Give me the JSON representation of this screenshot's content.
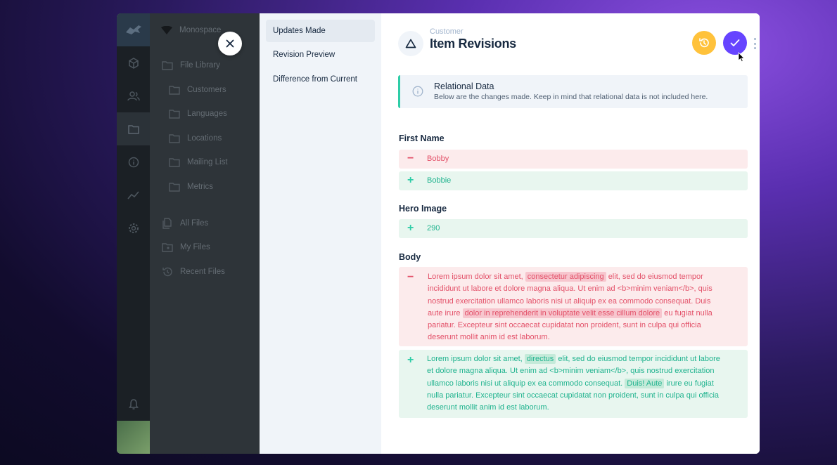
{
  "app": {
    "project_name": "Monospace",
    "nav_items": [
      "File Library",
      "Customers",
      "Languages",
      "Locations",
      "Mailing List",
      "Metrics",
      "All Files",
      "My Files",
      "Recent Files"
    ]
  },
  "drawer_nav": {
    "items": [
      "Updates Made",
      "Revision Preview",
      "Difference from Current"
    ],
    "active": "Updates Made"
  },
  "header": {
    "subtitle": "Customer",
    "title": "Item Revisions"
  },
  "notice": {
    "title": "Relational Data",
    "text": "Below are the changes made. Keep in mind that relational data is not included here."
  },
  "fields": {
    "first_name": {
      "label": "First Name",
      "removed": "Bobby",
      "added": "Bobbie"
    },
    "hero_image": {
      "label": "Hero Image",
      "added": "290"
    },
    "body": {
      "label": "Body",
      "removed": {
        "p1": "Lorem ipsum dolor sit amet,",
        "h1": "consectetur adipiscing",
        "p2": "elit, sed do eiusmod tempor",
        "p3": "incididunt ut labore et dolore magna aliqua. Ut enim ad <b>minim veniam</b>, quis",
        "p4": "nostrud exercitation ullamco laboris nisi ut aliquip ex ea commodo consequat. Duis",
        "p5": "aute irure",
        "h2": "dolor in reprehenderit in voluptate velit esse cillum dolore",
        "p6": "eu fugiat nulla",
        "p7": "pariatur. Excepteur sint occaecat cupidatat non proident, sunt in culpa qui officia",
        "p8": "deserunt mollit anim id est laborum."
      },
      "added": {
        "p1": "Lorem ipsum dolor sit amet,",
        "h1": "directus",
        "p2": "elit, sed do eiusmod tempor incididunt ut labore",
        "p3": "et dolore magna aliqua. Ut enim ad <b>minim veniam</b>, quis nostrud exercitation",
        "p4": "ullamco laboris nisi ut aliquip ex ea commodo consequat.",
        "h2": "Duis! Aute",
        "p5": "irure eu fugiat",
        "p6": "nulla pariatur. Excepteur sint occaecat cupidatat non proident, sunt in culpa qui officia",
        "p7": "deserunt mollit anim id est laborum."
      }
    }
  },
  "colors": {
    "accent": "#6644ff",
    "warning": "#ffc23b",
    "success": "#2ecda7",
    "danger": "#e35169"
  },
  "icons": [
    "close-icon",
    "triangle-icon",
    "history-icon",
    "check-icon",
    "more-vertical-icon",
    "info-icon",
    "minus-icon",
    "plus-icon"
  ]
}
